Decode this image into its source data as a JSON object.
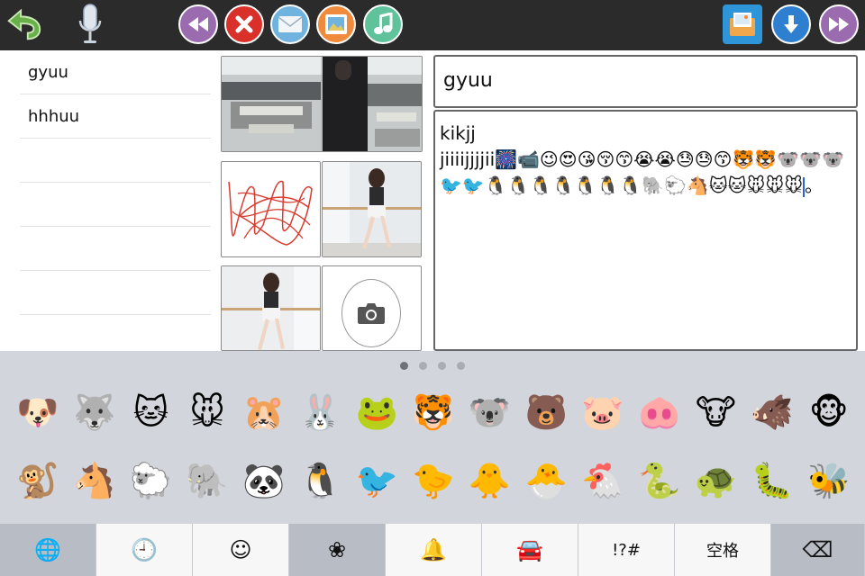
{
  "toolbar": {
    "back_icon": "undo-arrow-icon",
    "mic_icon": "microphone-icon",
    "buttons": [
      "rewind-icon",
      "close-icon",
      "mail-icon",
      "image-icon",
      "music-icon",
      "folder-image-icon",
      "download-icon",
      "fast-forward-icon"
    ],
    "colors": {
      "rewind": "#9b6bb0",
      "close": "#d9312a",
      "mail": "#6fb3de",
      "image": "#f08a3c",
      "music": "#5fc29a",
      "download": "#2f7fd1",
      "forward": "#9b6bb0"
    }
  },
  "notes": {
    "items": [
      {
        "label": "gyuu"
      },
      {
        "label": "hhhuu"
      }
    ]
  },
  "editor": {
    "title": "gyuu",
    "body_line1": "kikjj",
    "body_line2": "jiiiijjjjii🎆📹😉😍😘😚😙😭😭😓😓😙🐯🐯🐨🐨🐨🐦🐦🐧🐧🐧🐧🐧🐧🐧🐘🐑🐴🐱🐱🐭🐭🐭",
    "body_end": "。"
  },
  "keyboard": {
    "pages": 4,
    "active_page": 0,
    "row1": [
      "🐶",
      "🐺",
      "🐱",
      "🐭",
      "🐹",
      "🐰",
      "🐸",
      "🐯",
      "🐨",
      "🐻",
      "🐷",
      "🐽",
      "🐮",
      "🐗",
      "🐵"
    ],
    "row2": [
      "🐒",
      "🐴",
      "🐑",
      "🐘",
      "🐼",
      "🐧",
      "🐦",
      "🐤",
      "🐥",
      "🐣",
      "🐔",
      "🐍",
      "🐢",
      "🐛",
      "🐝"
    ],
    "categories": [
      {
        "name": "globe-icon",
        "glyph": "🌐"
      },
      {
        "name": "clock-icon",
        "glyph": "🕘"
      },
      {
        "name": "smiley-icon",
        "glyph": "☺"
      },
      {
        "name": "flower-icon",
        "glyph": "❀"
      },
      {
        "name": "bell-icon",
        "glyph": "🔔"
      },
      {
        "name": "car-icon",
        "glyph": "🚘"
      },
      {
        "name": "symbols-icon",
        "glyph": "!?#"
      },
      {
        "name": "space-key",
        "glyph": "空格"
      },
      {
        "name": "backspace-icon",
        "glyph": "⌫"
      }
    ]
  }
}
